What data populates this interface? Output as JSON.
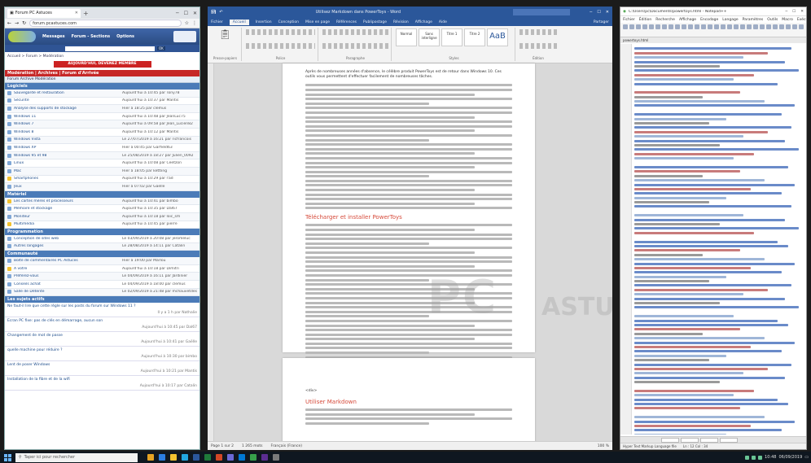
{
  "browser": {
    "tab_title": "Forum PC Astuces",
    "address": "forum.pcastuces.com",
    "nav": [
      "Messages",
      "Forum - Sections",
      "Options"
    ],
    "search_button": "OK",
    "breadcrumb": "Accueil > Forum > Modération",
    "cta": "AUJOURD'HUI, DEVENEZ MEMBRE",
    "forum_title": "Modération | Archives | Forum d'Arrivée",
    "forum_sub": "Forum Archive Modération",
    "sections": [
      {
        "title": "Logiciels",
        "rows": [
          {
            "name": "Sauvegarde et restauration",
            "date": "Aujourd'hui à 10:45 par Tony78",
            "icon": "folder"
          },
          {
            "name": "Sécurité",
            "date": "Aujourd'hui à 10:37 par Mantis",
            "icon": "folder"
          },
          {
            "name": "Analyse des supports de stockage",
            "date": "Hier à 18:25 par clemus",
            "icon": "folder"
          },
          {
            "name": "Windows 11",
            "date": "Aujourd'hui à 10:48 par JeanLuc75",
            "icon": "folder"
          },
          {
            "name": "Windows 7",
            "date": "Aujourd'hui à 09:58 par Jean_Lucien82",
            "icon": "folder"
          },
          {
            "name": "Windows 8",
            "date": "Aujourd'hui à 10:12 par Mantis",
            "icon": "folder"
          },
          {
            "name": "Windows Vista",
            "date": "Le 27/07/2019 à 16:21 par ricfrancois",
            "icon": "folder"
          },
          {
            "name": "Windows XP",
            "date": "Hier à 00:45 par Garfield63",
            "icon": "folder"
          },
          {
            "name": "Windows 95 et 98",
            "date": "Le 25/08/2019 à 18:27 par Julien_0092",
            "icon": "folder"
          },
          {
            "name": "Linux",
            "date": "Aujourd'hui à 10:08 par Ceetzon",
            "icon": "folder"
          },
          {
            "name": "Mac",
            "date": "Hier à 18:05 par kettling",
            "icon": "folder"
          },
          {
            "name": "Smartphones",
            "date": "Aujourd'hui à 10:29 par l'ad",
            "icon": "star"
          },
          {
            "name": "Jeux",
            "date": "Hier à 07:02 par Gaëlle",
            "icon": "folder"
          }
        ]
      },
      {
        "title": "Matériel",
        "rows": [
          {
            "name": "Les cartes mères et processeurs",
            "date": "Aujourd'hui à 10:41 par bimbo",
            "icon": "star"
          },
          {
            "name": "Mémoire et stockage",
            "date": "Aujourd'hui à 10:35 par Dal67",
            "icon": "folder"
          },
          {
            "name": "Moniteur",
            "date": "Aujourd'hui à 10:18 par loic_sm",
            "icon": "folder"
          },
          {
            "name": "Multimédia",
            "date": "Aujourd'hui à 10:45 par pierre",
            "icon": "star"
          }
        ]
      },
      {
        "title": "Programmation",
        "rows": [
          {
            "name": "Conception de sites web",
            "date": "Le 03/09/2019 à 20:08 par jeromeluc",
            "icon": "folder"
          },
          {
            "name": "Autres langages",
            "date": "Le 28/08/2019 à 14:11 par Catalin",
            "icon": "folder"
          }
        ]
      },
      {
        "title": "Communauté",
        "rows": [
          {
            "name": "Boîte de commentaires PC Astuces",
            "date": "Hier à 19:00 par Marlou",
            "icon": "folder"
          },
          {
            "name": "À votre",
            "date": "Aujourd'hui à 10:18 par Dimitri",
            "icon": "star"
          },
          {
            "name": "Préférez-vous",
            "date": "Le 04/09/2019 à 16:11 par Jardinier",
            "icon": "folder"
          },
          {
            "name": "Conseils achat",
            "date": "Le 04/09/2019 à 18:00 par clemus",
            "icon": "folder"
          },
          {
            "name": "Salle de Détente",
            "date": "Le 02/09/2019 à 21:48 par mchauvetdes",
            "icon": "folder"
          }
        ]
      }
    ],
    "last_topics_title": "Les sujets actifs",
    "topics": [
      {
        "title": "Ne faut-il lire que cette règle sur les posts du forum sur Windows 11 ?",
        "meta": "Il y a 1 h par Nathalie"
      },
      {
        "title": "Ecran PC fixe: pas de clés en démarrage, aucun son",
        "meta": "Aujourd'hui à 10:45 par Dal67"
      },
      {
        "title": "Changement de mot de passe",
        "meta": "Aujourd'hui à 10:41 par Gaëlle"
      },
      {
        "title": "quelle machine pour réduire ?",
        "meta": "Aujourd'hui à 10:30 par bimbo"
      },
      {
        "title": "Lent de poser Windows",
        "meta": "Aujourd'hui à 10:21 par Mantis"
      },
      {
        "title": "Installation de la fibre et de la wifi",
        "meta": "Aujourd'hui à 10:17 par Catalin"
      }
    ]
  },
  "word": {
    "title": "Utilisez Markdown dans PowerToys - Word",
    "menu_tabs": [
      "Fichier",
      "Accueil",
      "Insertion",
      "Conception",
      "Mise en page",
      "Références",
      "Publipostage",
      "Révision",
      "Affichage",
      "Aide"
    ],
    "active_tab": "Accueil",
    "share": "Partager",
    "groups": [
      "Presse-papiers",
      "Police",
      "Paragraphe",
      "Styles",
      "Édition"
    ],
    "styles": [
      "Normal",
      "Sans interligne",
      "Titre 1",
      "Titre 2"
    ],
    "style_big": "AaB",
    "page1_intro": "Après de nombreuses années d'absence, le célèbre produit PowerToys est de retour dans Windows 10. Ces outils vous permettent d'effectuer facilement de nombreuses tâches.",
    "page1_heading": "Télécharger et installer PowerToys",
    "page2_text": "<div>",
    "page2_heading": "Utiliser Markdown",
    "watermark_main": "PC",
    "watermark_sub": "ASTUCES",
    "status_page": "Page 1 sur 2",
    "status_words": "1 265 mots",
    "status_lang": "Français (France)",
    "zoom": "100 %"
  },
  "editor": {
    "title": "C:\\Users\\pc\\Documents\\powertoys.html - Notepad++",
    "menu": [
      "Fichier",
      "Édition",
      "Recherche",
      "Affichage",
      "Encodage",
      "Langage",
      "Paramètres",
      "Outils",
      "Macro",
      "Exécution",
      "?"
    ],
    "file_tab": "powertoys.html",
    "status_lang": "Hyper Text Markup Language file",
    "status_pos": "Ln : 12  Col : 34"
  },
  "taskbar": {
    "search_placeholder": "Taper ici pour rechercher",
    "app_colors": [
      "#e6a323",
      "#2b7de1",
      "#f2c230",
      "#22a6e0",
      "#2b579a",
      "#1f7a3a",
      "#d24726",
      "#6b69d6",
      "#0078d4",
      "#37a14a",
      "#5c2d91",
      "#7a7a7a"
    ],
    "time": "10:48",
    "date": "06/09/2019"
  }
}
